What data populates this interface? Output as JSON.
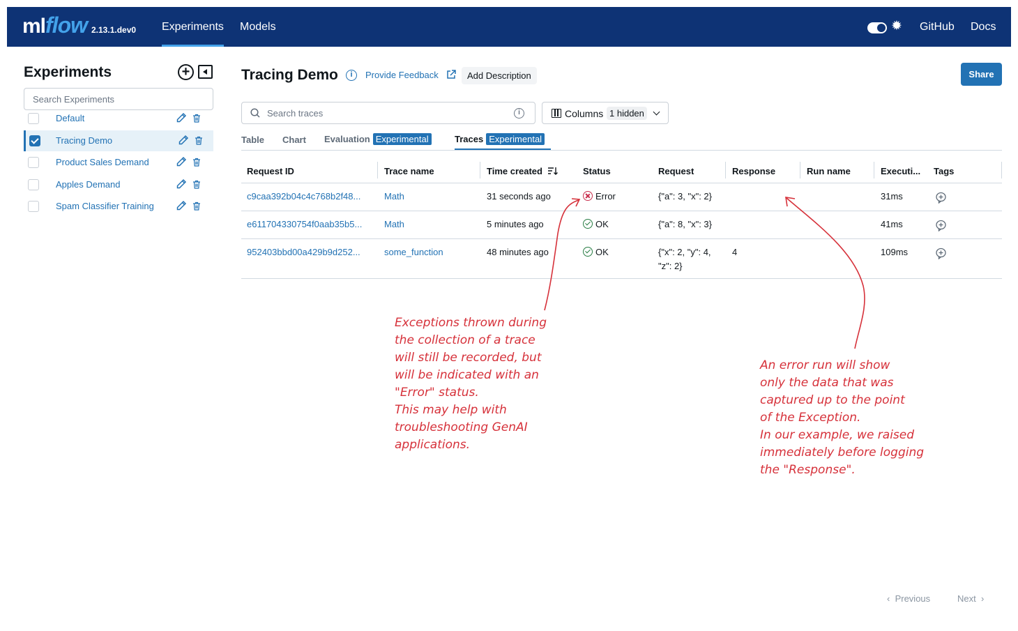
{
  "app": {
    "logo_ml": "ml",
    "logo_flow": "flow",
    "version": "2.13.1.dev0",
    "nav": [
      "Experiments",
      "Models"
    ],
    "right_links": [
      "GitHub",
      "Docs"
    ]
  },
  "sidebar": {
    "title": "Experiments",
    "search_placeholder": "Search Experiments",
    "experiments": [
      {
        "name": "Default",
        "selected": false
      },
      {
        "name": "Tracing Demo",
        "selected": true
      },
      {
        "name": "Product Sales Demand",
        "selected": false
      },
      {
        "name": "Apples Demand",
        "selected": false
      },
      {
        "name": "Spam Classifier Training",
        "selected": false
      }
    ]
  },
  "header": {
    "title": "Tracing Demo",
    "feedback": "Provide Feedback",
    "add_description": "Add Description",
    "share": "Share"
  },
  "toolbar": {
    "search_placeholder": "Search traces",
    "columns_label": "Columns",
    "hidden_badge": "1 hidden"
  },
  "tabs": {
    "table": "Table",
    "chart": "Chart",
    "evaluation": "Evaluation",
    "traces": "Traces",
    "experimental": "Experimental"
  },
  "table": {
    "headers": [
      "Request ID",
      "Trace name",
      "Time created",
      "Status",
      "Request",
      "Response",
      "Run name",
      "Executi...",
      "Tags"
    ],
    "rows": [
      {
        "request_id": "c9caa392b04c4c768b2f48...",
        "trace_name": "Math",
        "time": "31 seconds ago",
        "status": "Error",
        "request_l1": "{\"a\": 3, \"x\": 2}",
        "request_l2": "",
        "response": "",
        "run_name": "",
        "exec": "31ms"
      },
      {
        "request_id": "e611704330754f0aab35b5...",
        "trace_name": "Math",
        "time": "5 minutes ago",
        "status": "OK",
        "request_l1": "{\"a\": 8, \"x\": 3}",
        "request_l2": "",
        "response": "",
        "run_name": "",
        "exec": "41ms"
      },
      {
        "request_id": "952403bbd00a429b9d252...",
        "trace_name": "some_function",
        "time": "48 minutes ago",
        "status": "OK",
        "request_l1": "{\"x\": 2, \"y\": 4,",
        "request_l2": "\"z\": 2}",
        "response": "4",
        "run_name": "",
        "exec": "109ms"
      }
    ]
  },
  "annotations": {
    "left": [
      "Exceptions thrown during",
      "the collection of a trace",
      "will still be recorded, but",
      "will be indicated with an",
      "\"Error\" status.",
      "This may help with",
      "troubleshooting GenAI",
      "applications."
    ],
    "right": [
      "An error run will show",
      "only the data that was",
      "captured up to the point",
      "of the Exception.",
      "In our example, we raised",
      "immediately before logging",
      "the \"Response\"."
    ],
    "color": "#d6313a"
  },
  "pagination": {
    "previous": "Previous",
    "next": "Next"
  },
  "colors": {
    "nav_bg": "#0e3375",
    "accent": "#2272b4",
    "error": "#c82d4c",
    "ok": "#277c43"
  }
}
